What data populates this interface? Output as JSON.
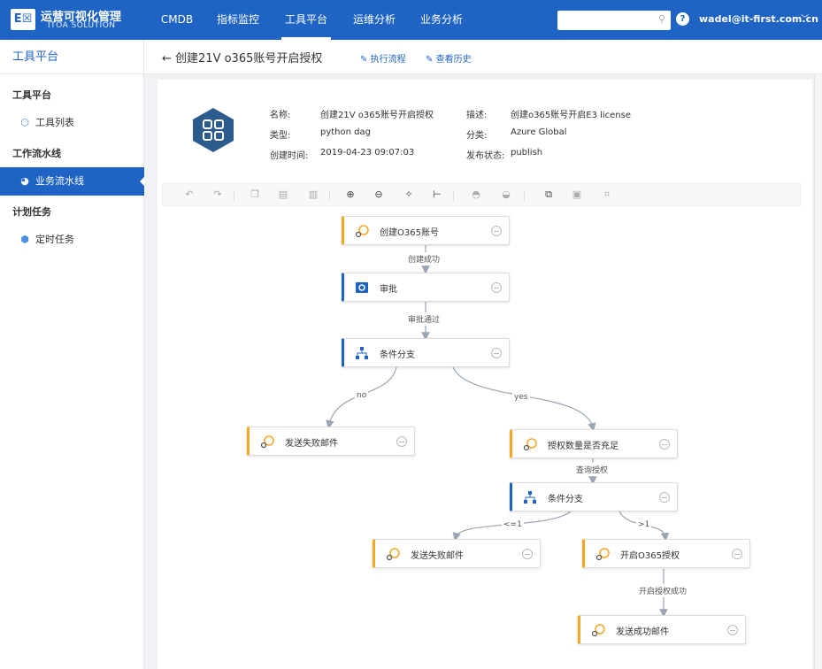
{
  "header": {
    "logo_mark": "E☒",
    "logo_title": "运营可视化管理",
    "logo_sub": "ITOA SOLUTION",
    "nav": [
      "CMDB",
      "指标监控",
      "工具平台",
      "运维分析",
      "业务分析"
    ],
    "active_nav": "工具平台",
    "search_placeholder": "",
    "user": "wadel@it-first.com.cn"
  },
  "sidebar": {
    "title": "工具平台",
    "sections": [
      {
        "label": "工具平台",
        "items": [
          {
            "label": "工具列表",
            "icon": "cube-icon"
          }
        ]
      },
      {
        "label": "工作流水线",
        "items": [
          {
            "label": "业务流水线",
            "icon": "dashboard-icon",
            "active": true
          }
        ]
      },
      {
        "label": "计划任务",
        "items": [
          {
            "label": "定时任务",
            "icon": "cubes-icon"
          }
        ]
      }
    ]
  },
  "page": {
    "back_title": "← 创建21V o365账号开启授权",
    "link_execute": "执行流程",
    "link_history": "查看历史",
    "info": {
      "name_label": "名称:",
      "name": "创建21V o365账号开启授权",
      "type_label": "类型:",
      "type": "python dag",
      "created_label": "创建时间:",
      "created": "2019-04-23 09:07:03",
      "desc_label": "描述:",
      "desc": "创建o365账号开启E3 license",
      "category_label": "分类:",
      "category": "Azure Global",
      "status_label": "发布状态:",
      "status": "publish"
    }
  },
  "flow": {
    "nodes": {
      "n1": "创建O365账号",
      "n2": "审批",
      "n3": "条件分支",
      "n4": "发送失败邮件",
      "n5": "授权数量是否充足",
      "n6": "条件分支",
      "n7": "发送失败邮件",
      "n8": "开启O365授权",
      "n9": "发送成功邮件"
    },
    "edges": {
      "e1": "创建成功",
      "e2": "审批通过",
      "e3": "no",
      "e4": "yes",
      "e5": "查询授权",
      "e6": "<=1",
      "e7": ">1",
      "e8": "开启授权成功"
    }
  },
  "colors": {
    "brand": "#1f64c4",
    "task_accent": "#f5a623"
  }
}
